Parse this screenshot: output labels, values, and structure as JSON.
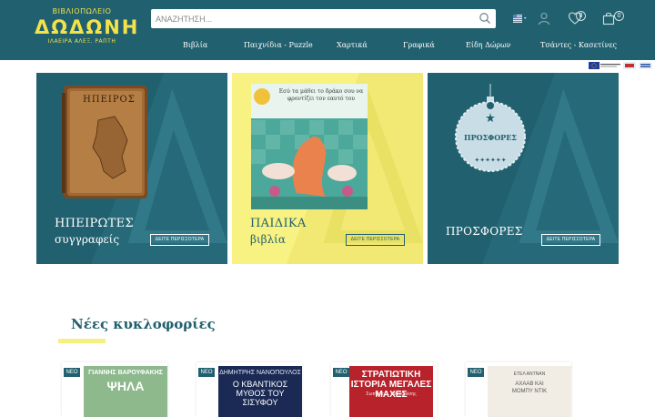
{
  "logo": {
    "line1": "ΒΙΒΛΙΟΠΩΛΕΙΟ",
    "line2": "ΔΩΔΩΝΗ",
    "line3": "ΙΛΑΕΙΡΑ ΑΛΕΞ. ΡΑΠΤΗ"
  },
  "search": {
    "placeholder": "ΑΝΑΖΗΤΗΣΗ..."
  },
  "header": {
    "wishlist_count": "0",
    "cart_count": "0"
  },
  "nav": [
    {
      "label": "Βιβλία"
    },
    {
      "label": "Παιχνίδια - Puzzle"
    },
    {
      "label": "Χαρτικά"
    },
    {
      "label": "Γραφικά"
    },
    {
      "label": "Είδη Δώρων"
    },
    {
      "label": "Τσάντες - Κασετίνες"
    }
  ],
  "banners": [
    {
      "title": "ΗΠΕΙΡΩΤΕΣ",
      "subtitle": "συγγραφείς",
      "button": "ΔΕΙΤΕ ΠΕΡΙΣΣΟΤΕΡΑ",
      "image_text": "ΗΠΕΙΡΟΣ"
    },
    {
      "title": "ΠΑΙΔΙΚΑ",
      "subtitle": "βιβλία",
      "button": "ΔΕΙΤΕ ΠΕΡΙΣΣΟΤΕΡΑ",
      "image_text": "Εσύ τα μάθει το δράκο σου να φροντίζει τον εαυτό του"
    },
    {
      "title": "ΠΡΟΣΦΟΡΕΣ",
      "subtitle": "",
      "button": "ΔΕΙΤΕ ΠΕΡΙΣΣΟΤΕΡΑ",
      "image_text": "ΠΡΟΣΦΟΡΕΣ"
    }
  ],
  "new_releases": {
    "title": "Νέες κυκλοφορίες",
    "badge": "ΝΕΟ",
    "products": [
      {
        "author": "ΓΙΑΝΝΗΣ ΒΑΡΟΥΦΑΚΗΣ",
        "cover_title": "ΨΗΛΑ"
      },
      {
        "author": "ΔΗΜΗΤΡΗΣ ΝΑΝΟΠΟΥΛΟΣ",
        "cover_title": "Ο ΚΒΑΝΤΙΚΟΣ ΜΥΘΟΣ ΤΟΥ ΣΙΣΥΦΟΥ"
      },
      {
        "author": "Σωτήρης Σ. Βαρβαρέσης",
        "cover_title": "ΣΤΡΑΤΙΩΤΙΚΗ ΙΣΤΟΡΙΑ ΜΕΓΑΛΕΣ ΜΑΧΕΣ"
      },
      {
        "author": "ΕΤΕΛ ΑΝΤΝΑΝ",
        "cover_title": "ΑΧΑΑΒ ΚΑΙ ΜΟΜΠΥ ΝΤΙΚ"
      }
    ]
  },
  "colors": {
    "primary": "#21606e",
    "accent": "#f3e24a",
    "banner_yellow": "#f8f283"
  }
}
